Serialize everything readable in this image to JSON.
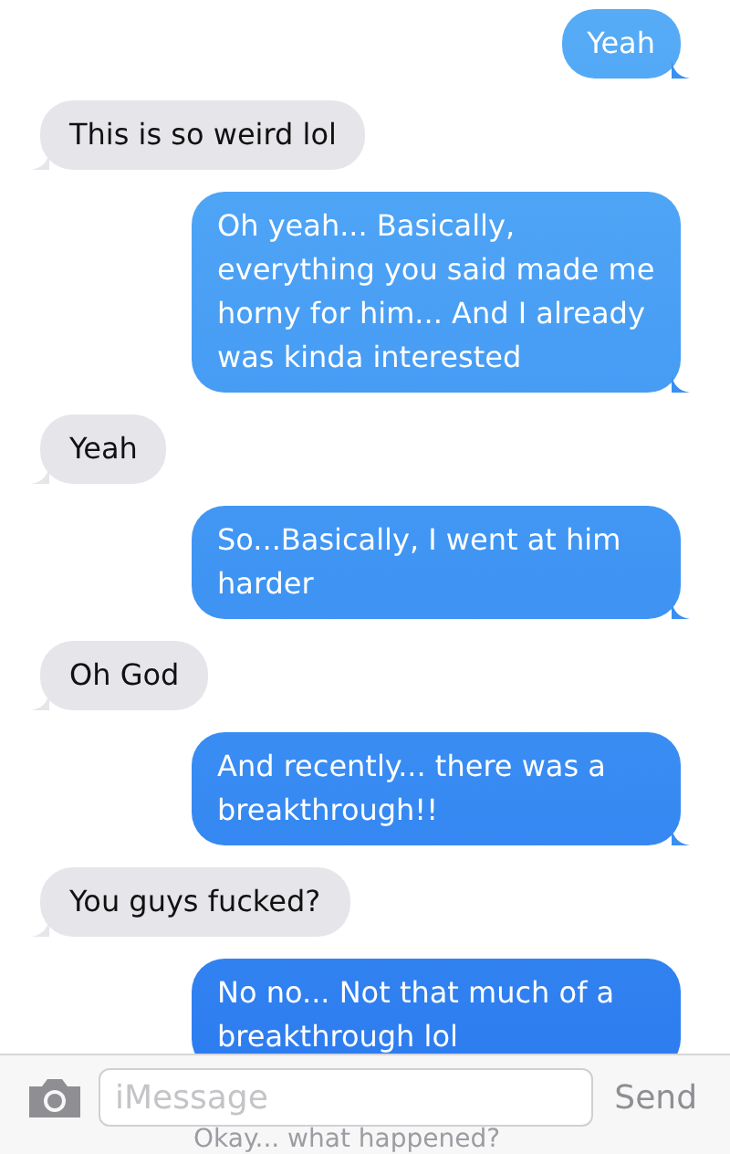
{
  "messages": [
    {
      "kind": "sent",
      "text": "Yeah"
    },
    {
      "kind": "received",
      "text": "This is so weird lol"
    },
    {
      "kind": "sent",
      "text": "Oh yeah... Basically, everything you said made me horny for him... And I already was kinda interested"
    },
    {
      "kind": "received",
      "text": "Yeah"
    },
    {
      "kind": "sent",
      "text": "So...Basically, I went at him harder"
    },
    {
      "kind": "received",
      "text": "Oh God"
    },
    {
      "kind": "sent",
      "text": "And recently... there was a breakthrough!!"
    },
    {
      "kind": "received",
      "text": "You guys fucked?"
    },
    {
      "kind": "sent",
      "text": "No no... Not that much of a breakthrough lol"
    }
  ],
  "compose": {
    "placeholder": "iMessage",
    "send": "Send",
    "ghost_text": "Okay... what happened?"
  }
}
